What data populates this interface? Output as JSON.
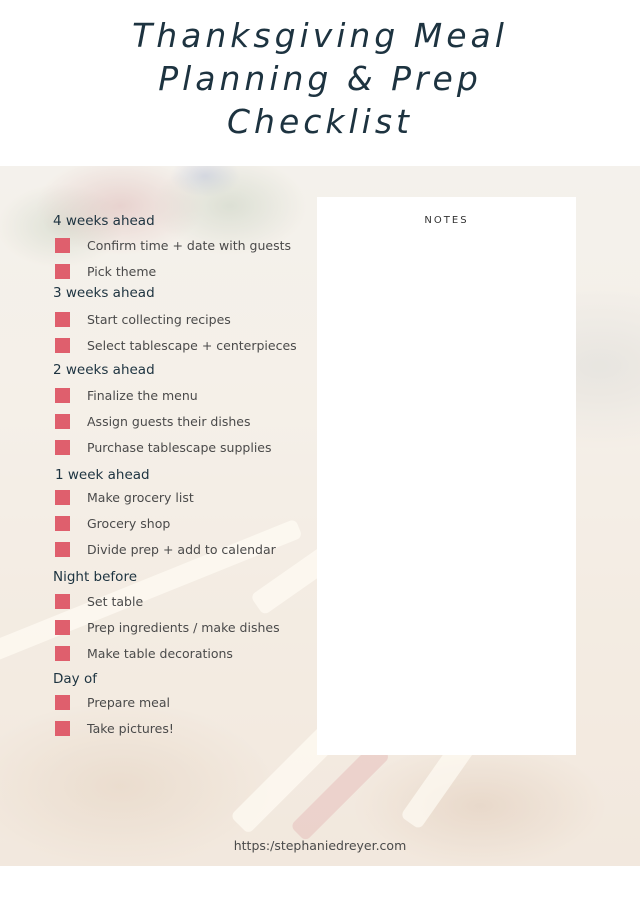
{
  "title": {
    "line1": "Thanksgiving Meal",
    "line2": "Planning & Prep",
    "line3": "Checklist"
  },
  "colors": {
    "title": "#1d3340",
    "checkbox": "#df5f6d",
    "item_text": "#4a4a4a"
  },
  "sections": [
    {
      "heading": "4 weeks ahead",
      "items": [
        "Confirm time + date with guests",
        "Pick theme"
      ]
    },
    {
      "heading": "3 weeks ahead",
      "items": [
        "Start collecting recipes",
        "Select tablescape + centerpieces"
      ]
    },
    {
      "heading": "2 weeks ahead",
      "items": [
        "Finalize the menu",
        "Assign guests their dishes",
        "Purchase tablescape supplies"
      ]
    },
    {
      "heading": "1 week ahead",
      "items": [
        "Make grocery list",
        "Grocery shop",
        "Divide prep + add to calendar"
      ]
    },
    {
      "heading": "Night before",
      "items": [
        "Set table",
        "Prep ingredients / make dishes",
        "Make table decorations"
      ]
    },
    {
      "heading": "Day of",
      "items": [
        "Prepare meal",
        "Take pictures!"
      ]
    }
  ],
  "notes": {
    "title": "NOTES"
  },
  "footer": {
    "url": "https:/stephaniedreyer.com"
  }
}
